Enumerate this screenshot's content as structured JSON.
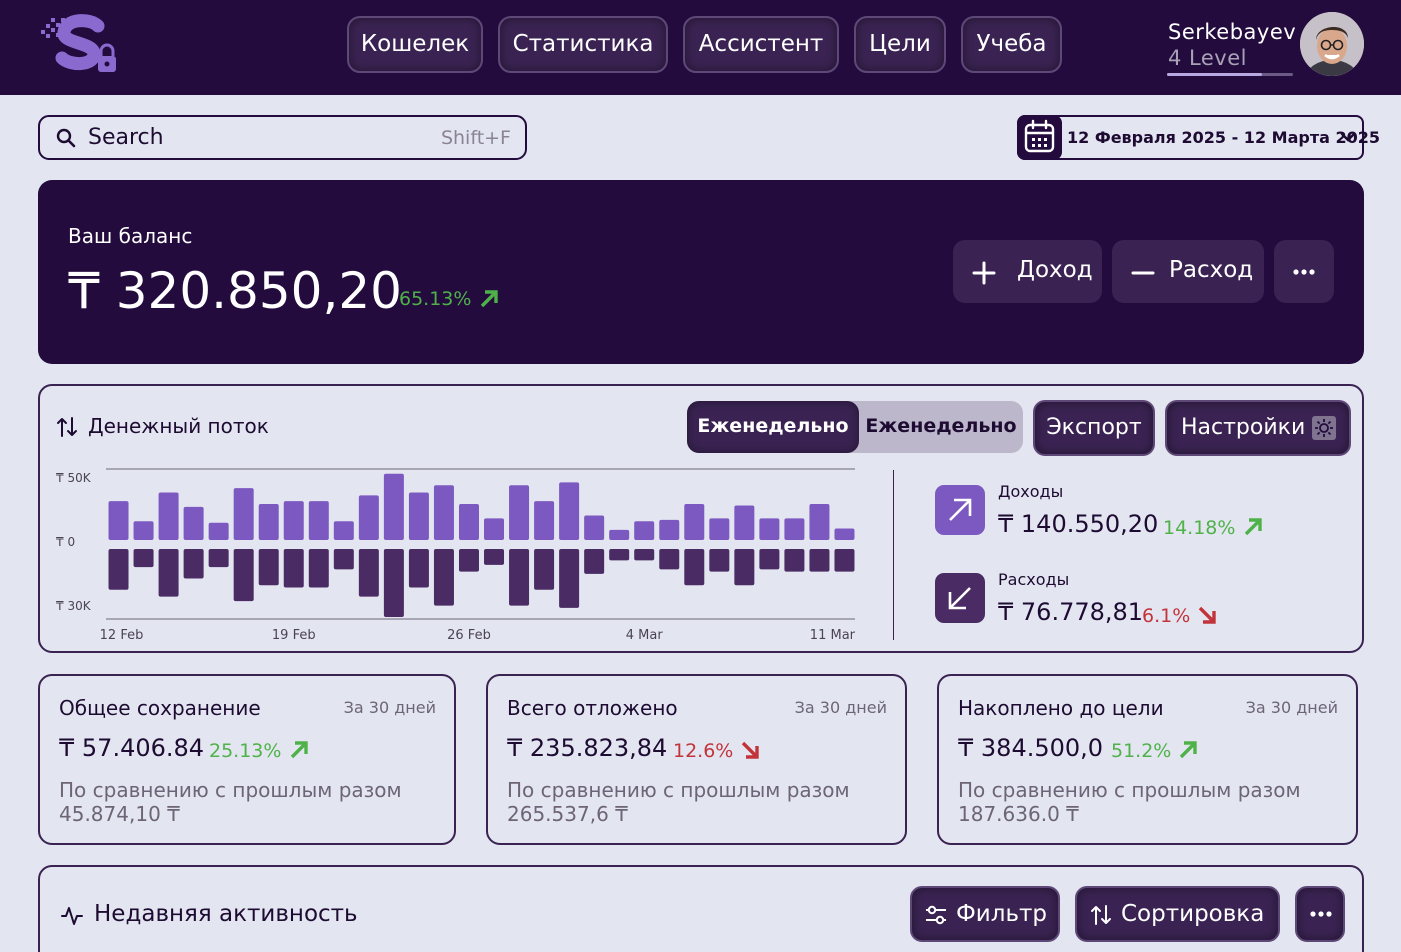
{
  "colors": {
    "brand_dark": "#230b3e",
    "button": "#3a2352",
    "accent_purple": "#7c58c1",
    "dark_purple": "#4a2b63",
    "positive": "#4fb248",
    "negative": "#c2343a",
    "background": "#e3e6f1"
  },
  "nav": {
    "items": [
      "Кошелек",
      "Статистика",
      "Ассистент",
      "Цели",
      "Учеба"
    ]
  },
  "user": {
    "name": "Serkebayev",
    "level": "4 Level",
    "level_progress": 0.75,
    "avatar_icon": "user-avatar"
  },
  "search": {
    "label": "Search",
    "shortcut": "Shift+F",
    "icon": "search-icon"
  },
  "date_range": {
    "text": "12 Февраля 2025 - 12 Марта 2025",
    "icon": "calendar-icon"
  },
  "balance": {
    "label": "Ваш баланс",
    "value": "₸ 320.850,20",
    "change": "65.13%",
    "change_direction": "up",
    "income_button": "Доход",
    "expense_button": "Расход",
    "more_button": "more-icon"
  },
  "cashflow": {
    "title": "Денежный поток",
    "toggle_active": "Еженедельно",
    "toggle_inactive": "Еженедельно",
    "export_button": "Экспорт",
    "settings_button": "Настройки",
    "income": {
      "label": "Доходы",
      "value": "₸ 140.550,20",
      "change": "14.18%",
      "direction": "up"
    },
    "expense": {
      "label": "Расходы",
      "value": "₸ 76.778,81",
      "change": "6.1%",
      "direction": "down"
    }
  },
  "chart_data": {
    "type": "bar",
    "y_ticks": [
      "₸ 50K",
      "₸ 0",
      "₸ 30K"
    ],
    "x_ticks": [
      "12 Feb",
      "19 Feb",
      "26 Feb",
      "4 Mar",
      "11 Mar"
    ],
    "ylim": [
      -30000,
      50000
    ],
    "series": [
      {
        "name": "Доходы",
        "color": "#7c58c1",
        "values": [
          27000,
          13000,
          33000,
          23000,
          12000,
          36000,
          25000,
          27000,
          27000,
          13000,
          31000,
          46000,
          33000,
          38000,
          25000,
          15000,
          38000,
          27000,
          40000,
          17000,
          7000,
          13000,
          14000,
          25000,
          15000,
          24000,
          15000,
          15000,
          25000,
          8000
        ]
      },
      {
        "name": "Расходы",
        "color": "#4a2b63",
        "values": [
          -18000,
          -8000,
          -21000,
          -13000,
          -8000,
          -23000,
          -16000,
          -17000,
          -17000,
          -9000,
          -21000,
          -30000,
          -17000,
          -25000,
          -10000,
          -7000,
          -25000,
          -18000,
          -26000,
          -11000,
          -5000,
          -5000,
          -9000,
          -16000,
          -10000,
          -16000,
          -9000,
          -10000,
          -10000,
          -10000
        ]
      }
    ],
    "grid": false
  },
  "cards": [
    {
      "title": "Общее сохранение",
      "period": "За 30 дней",
      "value": "₸ 57.406.84",
      "change": "25.13%",
      "direction": "up",
      "compare_label": "По сравнению с прошлым разом",
      "compare_value": "45.874,10 ₸"
    },
    {
      "title": "Всего отложено",
      "period": "За 30 дней",
      "value": "₸ 235.823,84",
      "change": "12.6%",
      "direction": "down",
      "compare_label": "По сравнению с прошлым разом",
      "compare_value": "265.537,6 ₸"
    },
    {
      "title": "Накоплено до цели",
      "period": "За 30 дней",
      "value": "₸ 384.500,0",
      "change": "51.2%",
      "direction": "up",
      "compare_label": "По сравнению с прошлым разом",
      "compare_value": "187.636.0 ₸"
    }
  ],
  "activity": {
    "title": "Недавняя активность",
    "filter_button": "Фильтр",
    "sort_button": "Сортировка"
  }
}
